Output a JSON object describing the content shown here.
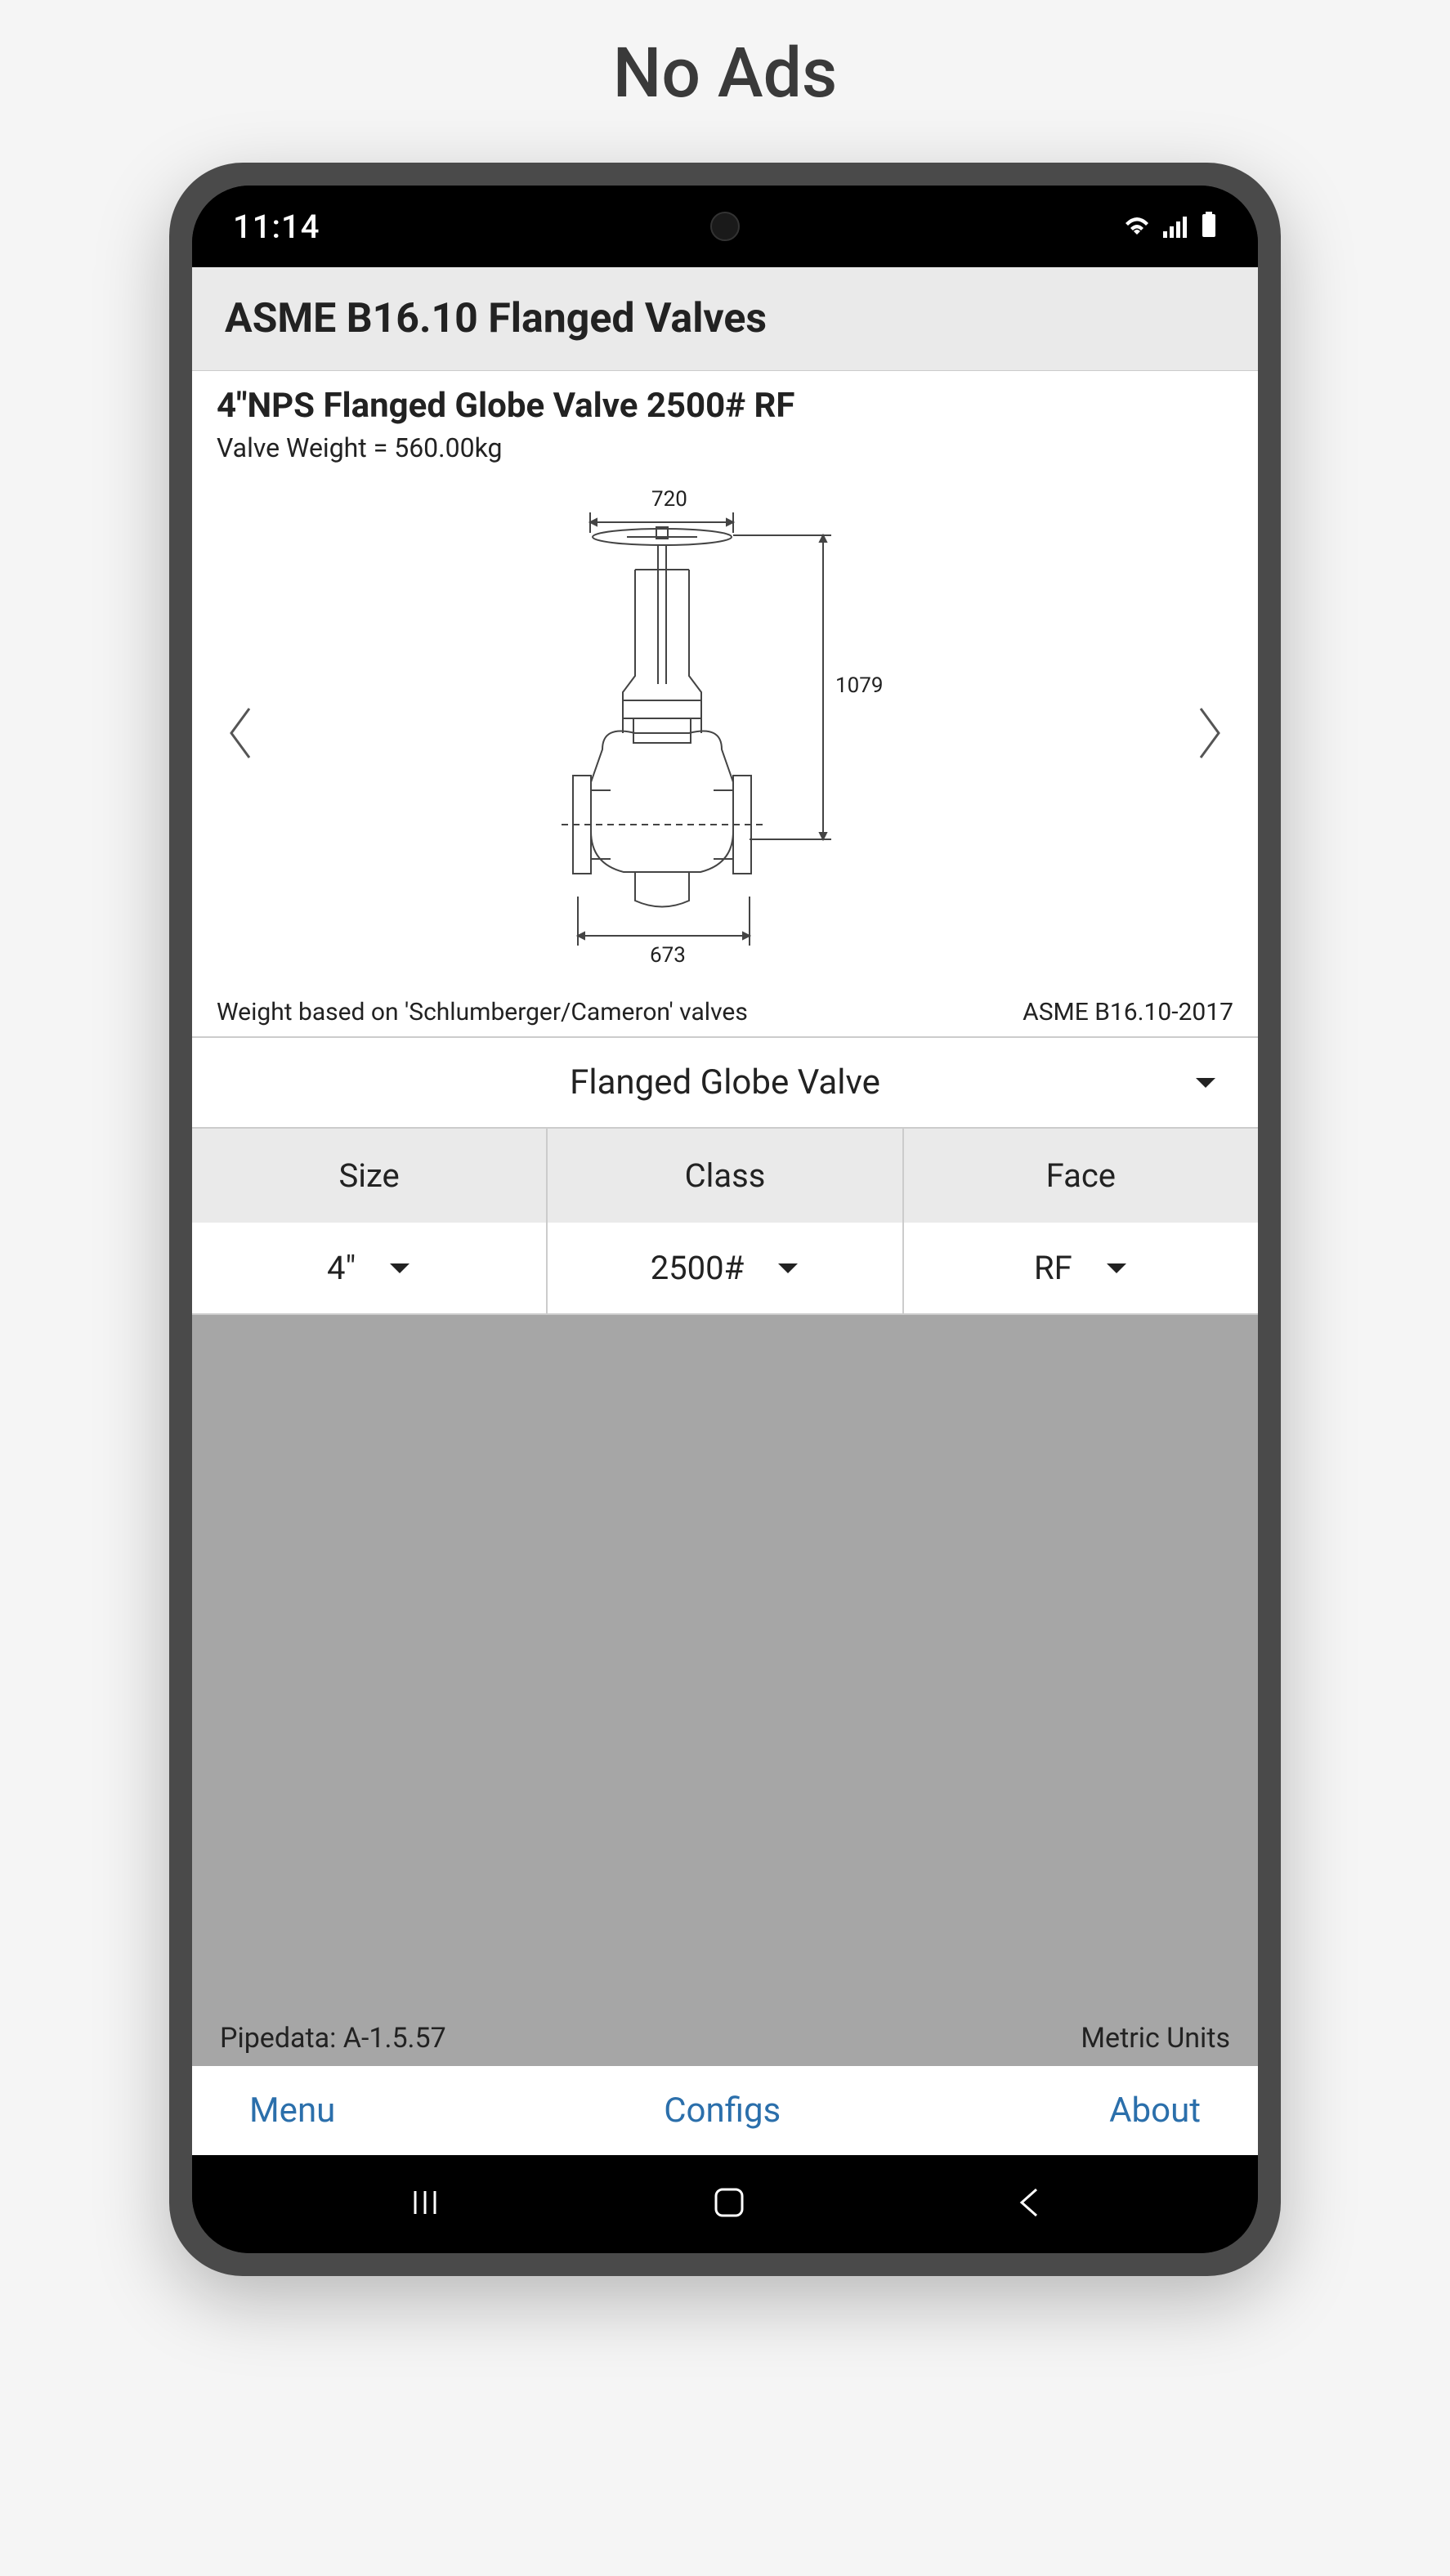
{
  "promo": {
    "title": "No Ads"
  },
  "status": {
    "time": "11:14"
  },
  "header": {
    "title": "ASME B16.10 Flanged Valves"
  },
  "valve": {
    "title": "4\"NPS Flanged Globe Valve 2500# RF",
    "weight_line": "Valve Weight = 560.00kg",
    "dims": {
      "top": "720",
      "height": "1079",
      "base": "673"
    },
    "footnote_left": "Weight based on 'Schlumberger/Cameron' valves",
    "footnote_right": "ASME B16.10-2017"
  },
  "selectors": {
    "valve_type": "Flanged Globe Valve",
    "headers": {
      "size": "Size",
      "class": "Class",
      "face": "Face"
    },
    "values": {
      "size": "4\"",
      "class": "2500#",
      "face": "RF"
    }
  },
  "footer": {
    "left": "Pipedata: A-1.5.57",
    "right": "Metric Units"
  },
  "nav": {
    "menu": "Menu",
    "configs": "Configs",
    "about": "About"
  }
}
